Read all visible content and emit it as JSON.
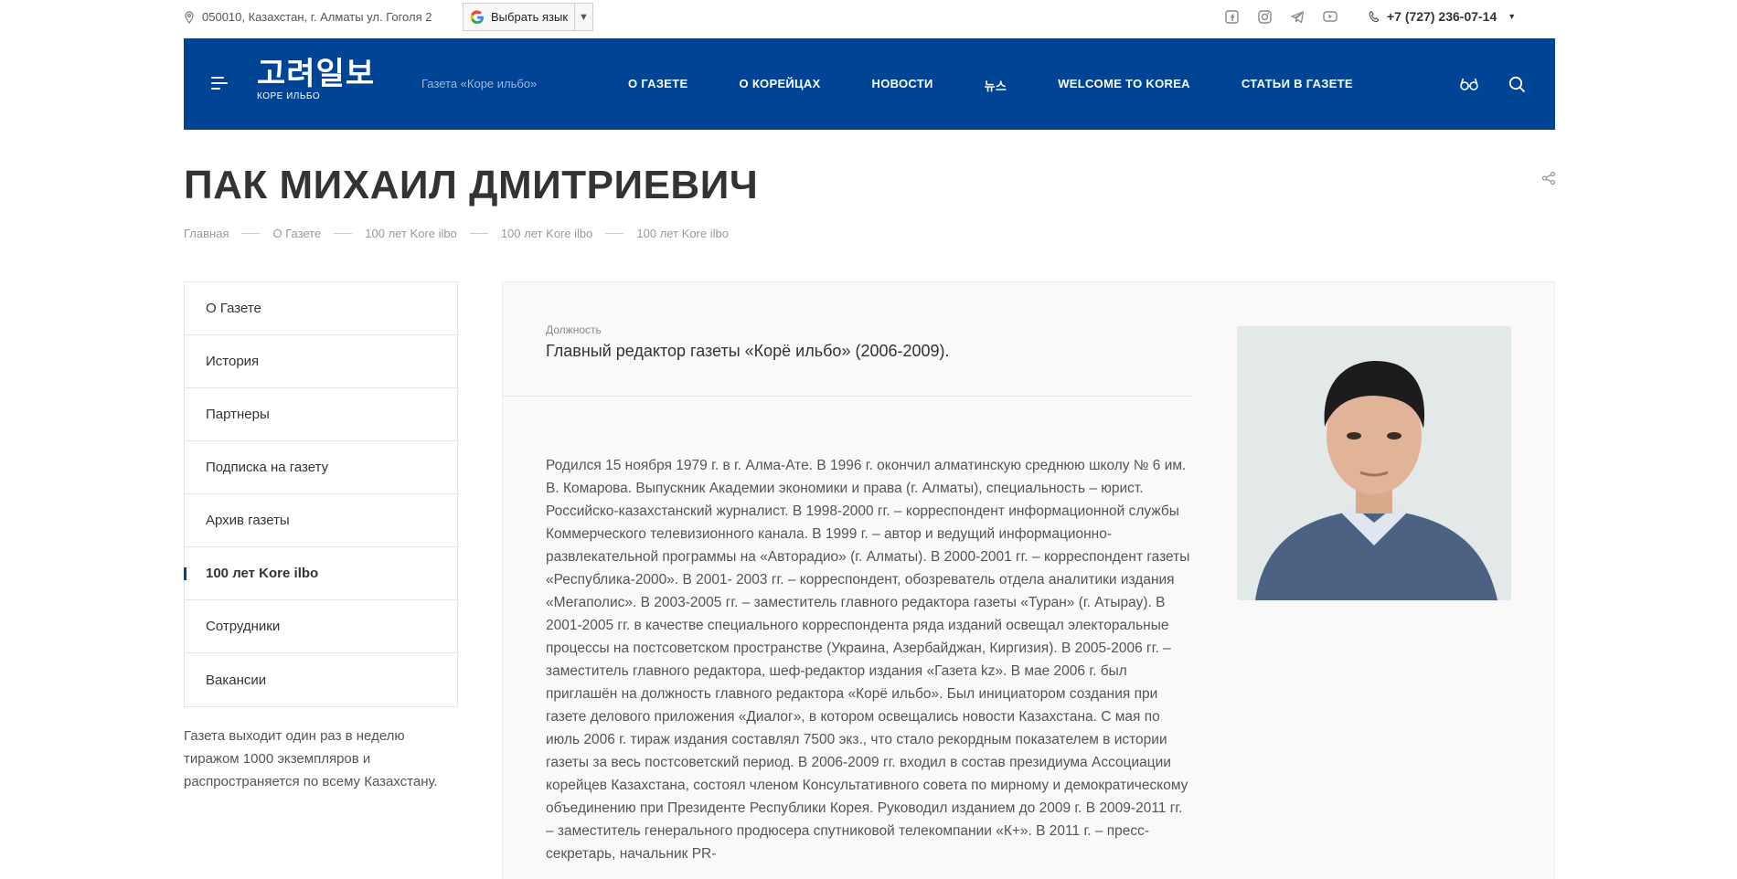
{
  "topbar": {
    "address": "050010, Казахстан, г. Алматы ул. Гоголя 2",
    "language_label": "Выбрать язык",
    "phone": "+7 (727) 236-07-14"
  },
  "social_icons": [
    "facebook-icon",
    "instagram-icon",
    "telegram-icon",
    "youtube-icon"
  ],
  "nav": {
    "logo_korean": "고려일보",
    "logo_russian": "КОРЕ ИЛЬБО",
    "tagline": "Газета «Коре ильбо»",
    "items": [
      {
        "label": "О ГАЗЕТЕ"
      },
      {
        "label": "О КОРЕЙЦАХ"
      },
      {
        "label": "НОВОСТИ"
      },
      {
        "label": "뉴스"
      },
      {
        "label": "WELCOME TO KOREA"
      },
      {
        "label": "СТАТЬИ В ГАЗЕТЕ"
      }
    ]
  },
  "page": {
    "title": "ПАК МИХАИЛ ДМИТРИЕВИЧ",
    "breadcrumbs": [
      "Главная",
      "О Газете",
      "100 лет Kore ilbo",
      "100 лет Kore ilbo",
      "100 лет Kore ilbo"
    ]
  },
  "sidebar": {
    "items": [
      {
        "label": "О Газете"
      },
      {
        "label": "История"
      },
      {
        "label": "Партнеры"
      },
      {
        "label": "Подписка на газету"
      },
      {
        "label": "Архив газеты"
      },
      {
        "label": "100 лет Kore ilbo"
      },
      {
        "label": "Сотрудники"
      },
      {
        "label": "Вакансии"
      }
    ],
    "active_index": 5,
    "note": "Газета выходит один раз в неделю тиражом 1000 экземпляров и распространяется по всему Казахстану."
  },
  "profile": {
    "position_label": "Должность",
    "position_value": "Главный редактор газеты «Корё ильбо» (2006-2009).",
    "bio": "Родился 15 ноября 1979 г. в г. Алма-Ате. В 1996 г. окончил алматинскую среднюю школу № 6 им. В. Комарова. Выпускник Академии экономики и права (г. Алматы), специальность – юрист. Российско-казахстанский журналист. В 1998-2000 гг. – корреспондент информационной службы Коммерческого телевизионного канала. В 1999 г. – автор и ведущий информационно-развлекательной программы на «Авторадио» (г. Алматы). В 2000-2001 гг. – корреспондент газеты «Республика-2000». В 2001- 2003 гг. – корреспондент, обозреватель отдела аналитики издания «Мегаполис». В 2003-2005 гг. – заместитель главного редактора газеты «Туран» (г. Атырау). В 2001-2005 гг. в качестве специального корреспондента ряда изданий освещал электоральные процессы на постсоветском пространстве (Украина, Азербайджан, Киргизия). В 2005-2006 гг. – заместитель главного редактора, шеф-редактор издания «Газета kz». В мае 2006 г. был приглашён на должность главного редактора «Корё ильбо». Был инициатором создания при газете делового приложения «Диалог», в котором освещались новости Казахстана. С мая по июль 2006 г. тираж издания составлял 7500 экз., что стало рекордным показателем в истории газеты за весь постсоветский период. В 2006-2009 гг. входил в состав президиума Ассоциации корейцев Казахстана, состоял членом Консультативного совета по мирному и демократическому объединению при Президенте Республики Корея. Руководил изданием до 2009 г. В 2009-2011 гг. – заместитель генерального продюсера спутниковой телекомпании «К+». В 2011 г. – пресс-секретарь, начальник PR-"
  },
  "colors": {
    "nav_bg": "#004595",
    "accent": "#004595"
  }
}
